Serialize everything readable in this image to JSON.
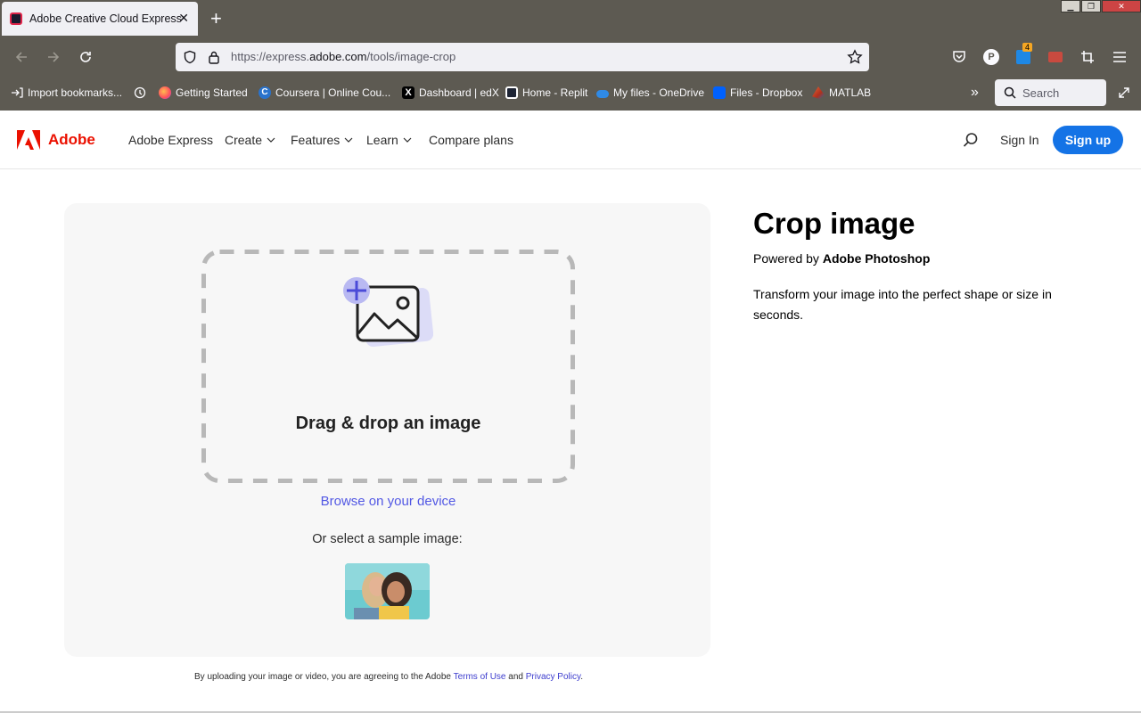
{
  "browser": {
    "tab_title": "Adobe Creative Cloud Express",
    "tab_close": "✕",
    "new_tab": "+",
    "url_prefix": "https://express.",
    "url_domain": "adobe.com",
    "url_path": "/tools/image-crop",
    "extension_badge": "4",
    "profile_initial": "P",
    "bookmarks": [
      {
        "label": "Import bookmarks...",
        "icon": "import-icon"
      },
      {
        "label": "",
        "icon": "history-icon"
      },
      {
        "label": "Getting Started",
        "icon": "firefox-icon"
      },
      {
        "label": "Coursera | Online Cou...",
        "icon": "coursera-icon"
      },
      {
        "label": "Dashboard | edX",
        "icon": "edx-icon"
      },
      {
        "label": "Home - Replit",
        "icon": "replit-icon"
      },
      {
        "label": "My files - OneDrive",
        "icon": "onedrive-icon"
      },
      {
        "label": "Files - Dropbox",
        "icon": "dropbox-icon"
      },
      {
        "label": "MATLAB",
        "icon": "matlab-icon"
      }
    ],
    "search_placeholder": "Search"
  },
  "header": {
    "logo_text": "Adobe",
    "nav": [
      {
        "label": "Adobe Express",
        "dropdown": false
      },
      {
        "label": "Create",
        "dropdown": true
      },
      {
        "label": "Features",
        "dropdown": true
      },
      {
        "label": "Learn",
        "dropdown": true
      },
      {
        "label": "Compare plans",
        "dropdown": false
      }
    ],
    "sign_in": "Sign In",
    "sign_up": "Sign up"
  },
  "upload": {
    "drop_title": "Drag & drop an image",
    "browse": "Browse on your device",
    "sample_label": "Or select a sample image:"
  },
  "legal": {
    "prefix": "By uploading your image or video, you are agreeing to the Adobe ",
    "terms": "Terms of Use",
    "and": " and ",
    "privacy": "Privacy Policy",
    "suffix": "."
  },
  "hero": {
    "title": "Crop image",
    "powered_prefix": "Powered by ",
    "powered_product": "Adobe Photoshop",
    "description": "Transform your image into the perfect shape or size in seconds."
  },
  "colors": {
    "brand_red": "#eb1000",
    "primary_blue": "#1473e6",
    "link_purple": "#5258e4",
    "chrome_bg": "#5d5a52"
  }
}
